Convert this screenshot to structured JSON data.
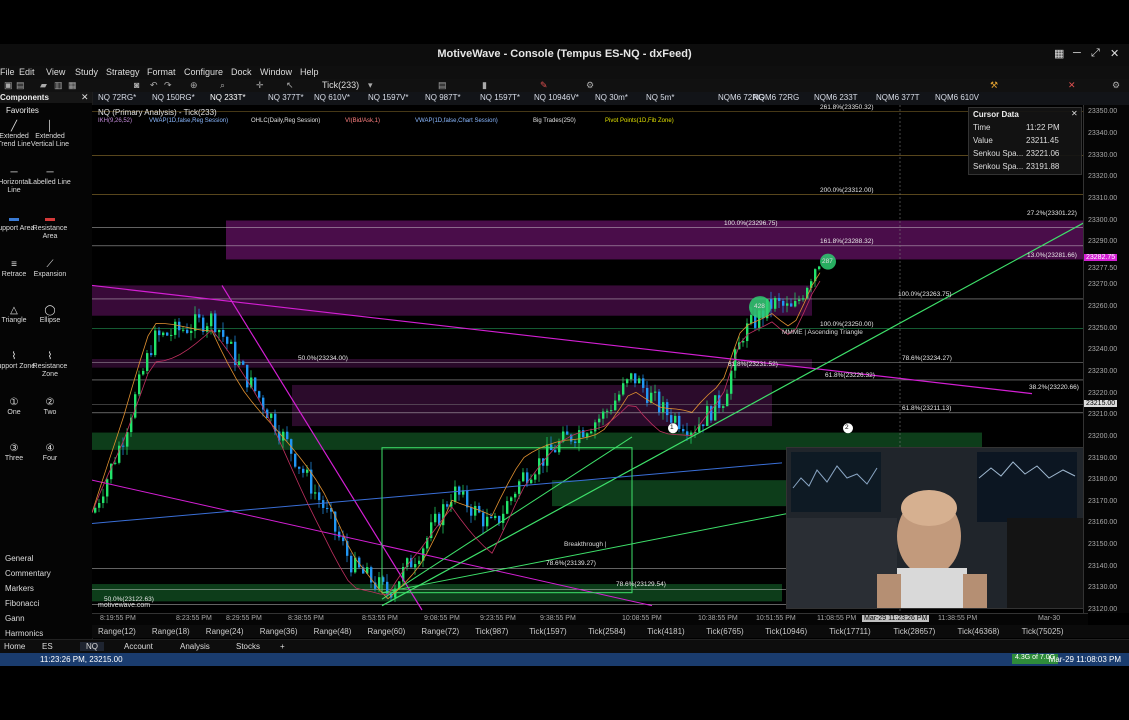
{
  "window": {
    "title": "MotiveWave - Console (Tempus ES-NQ - dxFeed)"
  },
  "menu": [
    "File",
    "Edit",
    "View",
    "Study",
    "Strategy",
    "Format",
    "Configure",
    "Dock",
    "Window",
    "Help"
  ],
  "toolbar": {
    "bar_size": "Tick(233)"
  },
  "chart_tabs": [
    "NQ 72RG*",
    "NQ 150RG*",
    "NQ 233T*",
    "NQ 377T*",
    "NQ 610V*",
    "NQ 1597V*",
    "NQ 987T*",
    "NQ 1597T*",
    "NQ 10946V*",
    "NQ 30m*",
    "NQ 5m*",
    "NQM6 72RG",
    "NQM6 72RG",
    "NQM6 233T",
    "NQM6 377T",
    "NQM6 610V"
  ],
  "sidebar": {
    "title": "Components",
    "favorites": "Favorites",
    "tools": [
      {
        "label": "Extended Trend Line",
        "icon": "extended-trend-line-icon",
        "glyph": "╱"
      },
      {
        "label": "Extended Vertical Line",
        "icon": "extended-vertical-line-icon",
        "glyph": "│"
      },
      {
        "label": "Horizontal Line",
        "icon": "horizontal-line-icon",
        "glyph": "─"
      },
      {
        "label": "Labelled Line",
        "icon": "labelled-line-icon",
        "glyph": "─"
      },
      {
        "label": "Support Area",
        "icon": "support-area-icon",
        "glyph": "▬"
      },
      {
        "label": "Resistance Area",
        "icon": "resistance-area-icon",
        "glyph": "▬"
      },
      {
        "label": "Retrace",
        "icon": "retrace-icon",
        "glyph": "≡"
      },
      {
        "label": "Expansion",
        "icon": "expansion-icon",
        "glyph": "⟋"
      },
      {
        "label": "Triangle",
        "icon": "triangle-icon",
        "glyph": "△"
      },
      {
        "label": "Ellipse",
        "icon": "ellipse-icon",
        "glyph": "◯"
      },
      {
        "label": "Support Zone",
        "icon": "support-zone-icon",
        "glyph": "⌇"
      },
      {
        "label": "Resistance Zone",
        "icon": "resistance-zone-icon",
        "glyph": "⌇"
      },
      {
        "label": "One",
        "icon": "one-icon",
        "glyph": "①"
      },
      {
        "label": "Two",
        "icon": "two-icon",
        "glyph": "②"
      },
      {
        "label": "Three",
        "icon": "three-icon",
        "glyph": "③"
      },
      {
        "label": "Four",
        "icon": "four-icon",
        "glyph": "④"
      }
    ],
    "categories": [
      "General",
      "Commentary",
      "Markers",
      "Fibonacci",
      "Gann",
      "Harmonics"
    ]
  },
  "chart": {
    "header": "NQ (Primary Analysis) - Tick(233)",
    "studies": [
      "IKH(9,26,52)",
      "VWAP(1D,false,Reg Session)",
      "OHLC(Daily,Reg Session)",
      "VI(Bid/Ask,1)",
      "VWAP(1D,false,Chart Session)",
      "Big Trades(250)",
      "Pivot Points(1D,Fib Zone)"
    ],
    "watermark": "motivewave.com",
    "levels": [
      {
        "label": "261.8%(23350.32)",
        "price": 23350.32
      },
      {
        "label": "200.0%(23312.00)",
        "price": 23312.0
      },
      {
        "label": "100.0%(23296.75)",
        "price": 23296.75
      },
      {
        "label": "161.8%(23288.32)",
        "price": 23288.32
      },
      {
        "label": "100.0%(23263.75)",
        "price": 23263.75
      },
      {
        "label": "100.0%(23250.00)",
        "price": 23250.0
      },
      {
        "label": "50.0%(23234.00)",
        "price": 23234.0
      },
      {
        "label": "78.6%(23234.27)",
        "price": 23234.27
      },
      {
        "label": "61.8%(23231.52)",
        "price": 23231.52
      },
      {
        "label": "61.8%(23226.32)",
        "price": 23226.32
      },
      {
        "label": "61.8%(23211.13)",
        "price": 23211.13
      },
      {
        "label": "78.6%(23139.27)",
        "price": 23139.27
      },
      {
        "label": "78.6%(23129.54)",
        "price": 23129.54
      },
      {
        "label": "50.0%(23122.63)",
        "price": 23122.63
      },
      {
        "label": "27.2%(23301.22)",
        "price": 23301.22
      },
      {
        "label": "13.0%(23281.66)",
        "price": 23281.66
      },
      {
        "label": "38.2%(23220.66)",
        "price": 23220.66
      }
    ],
    "annotations": {
      "pattern": "MMME | Ascending Triangle",
      "breakthrough": "Breakthrough |",
      "marker1": "1",
      "marker2": "2",
      "big_trade_1": "428",
      "big_trade_2": "287"
    }
  },
  "price_axis": [
    "23350.00",
    "23340.00",
    "23330.00",
    "23320.00",
    "23310.00",
    "23300.00",
    "23290.00",
    "23282.75",
    "23277.50",
    "23270.00",
    "23260.00",
    "23250.00",
    "23240.00",
    "23230.00",
    "23220.00",
    "23215.00",
    "23210.00",
    "23200.00",
    "23190.00",
    "23180.00",
    "23170.00",
    "23160.00",
    "23150.00",
    "23140.00",
    "23130.00",
    "23120.00"
  ],
  "time_axis": [
    "8:19:55 PM",
    "8:23:55 PM",
    "8:29:55 PM",
    "8:38:55 PM",
    "8:53:55 PM",
    "9:08:55 PM",
    "9:23:55 PM",
    "9:38:55 PM",
    "10:08:55 PM",
    "10:38:55 PM",
    "10:51:55 PM",
    "11:08:55 PM",
    "Mar-29 11:23:26 PM",
    "11:38:55 PM",
    "Mar-30"
  ],
  "bar_types": [
    "Range(12)",
    "Range(18)",
    "Range(24)",
    "Range(36)",
    "Range(48)",
    "Range(60)",
    "Range(72)",
    "Tick(987)",
    "Tick(1597)",
    "Tick(2584)",
    "Tick(4181)",
    "Tick(6765)",
    "Tick(10946)",
    "Tick(17711)",
    "Tick(28657)",
    "Tick(46368)",
    "Tick(75025)"
  ],
  "cursor_data": {
    "title": "Cursor Data",
    "rows": [
      {
        "label": "Time",
        "value": "11:22 PM"
      },
      {
        "label": "Value",
        "value": "23211.45"
      },
      {
        "label": "Senkou Spa...",
        "value": "23221.06"
      },
      {
        "label": "Senkou Spa...",
        "value": "23191.88"
      }
    ]
  },
  "bottom_tabs": [
    "Home",
    "ES",
    "NQ",
    "Account",
    "Analysis",
    "Stocks"
  ],
  "status": {
    "left": "11:23:26 PM, 23215.00",
    "right": "Mar-29 11:08:03 PM",
    "badge": "4.3G of 7.0G"
  },
  "colors": {
    "bull": "#22e36a",
    "bear": "#2196f3",
    "magenta": "#d41fd4",
    "zone_magenta": "#5a0f5a",
    "zone_green": "#0f4a1f",
    "status_blue": "#1a3c6e"
  }
}
